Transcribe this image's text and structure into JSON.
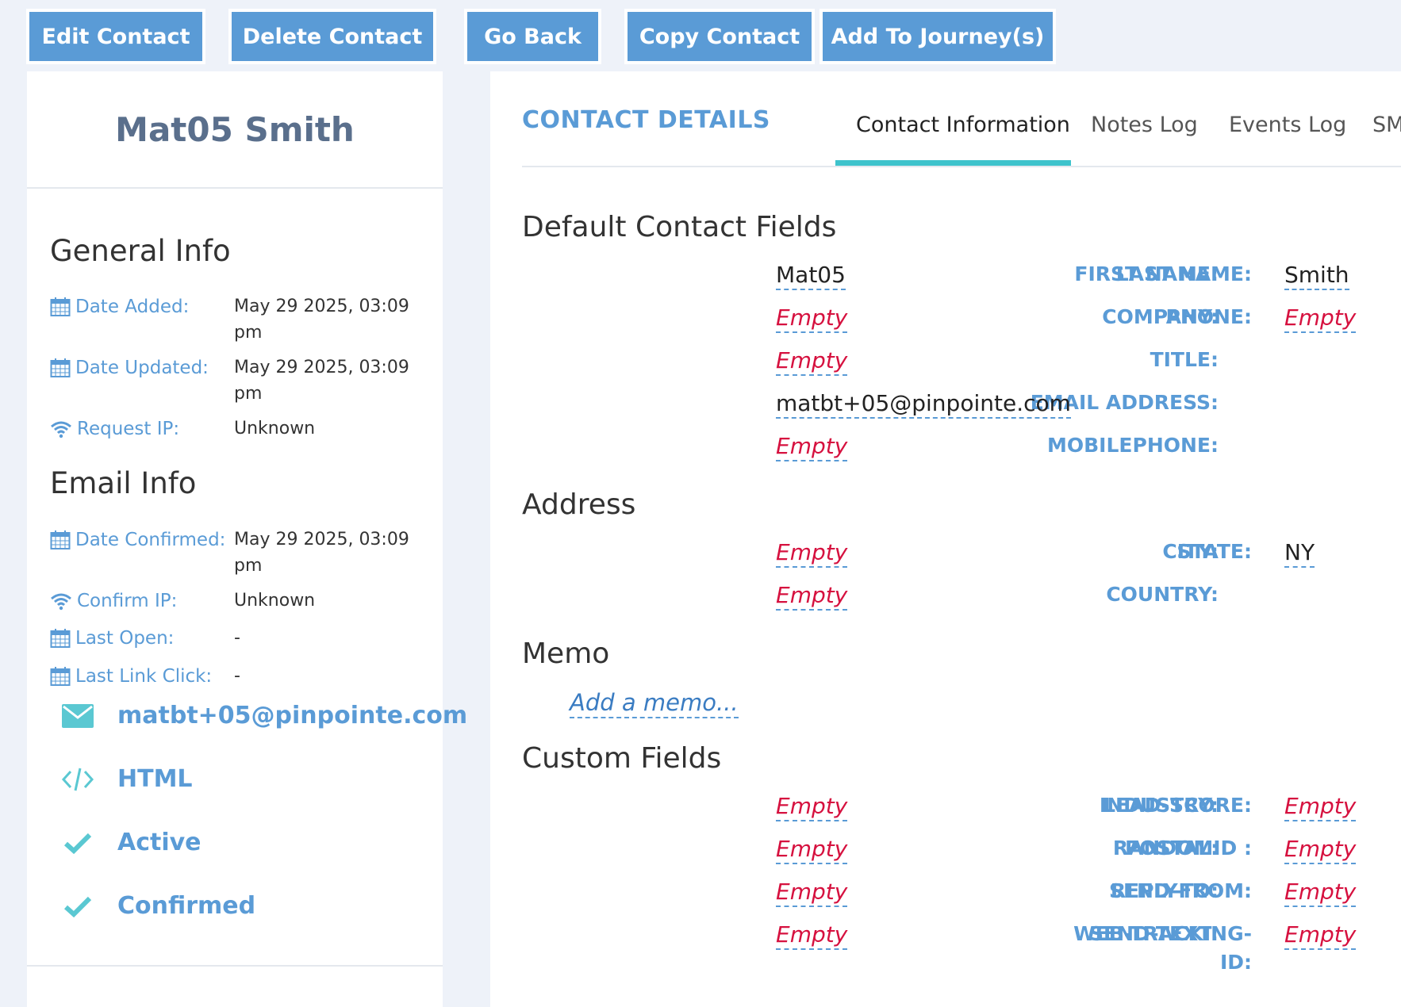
{
  "toolbar": {
    "edit": "Edit Contact",
    "delete": "Delete Contact",
    "back": "Go Back",
    "copy": "Copy Contact",
    "journey": "Add To Journey(s)"
  },
  "contact": {
    "name": "Mat05 Smith"
  },
  "general_info": {
    "title": "General Info",
    "date_added_label": "Date Added:",
    "date_added_value": "May 29 2025, 03:09 pm",
    "date_updated_label": "Date Updated:",
    "date_updated_value": "May 29 2025, 03:09 pm",
    "request_ip_label": "Request IP:",
    "request_ip_value": "Unknown"
  },
  "email_info": {
    "title": "Email Info",
    "date_confirmed_label": "Date Confirmed:",
    "date_confirmed_value": "May 29 2025, 03:09 pm",
    "confirm_ip_label": "Confirm IP:",
    "confirm_ip_value": "Unknown",
    "last_open_label": "Last Open:",
    "last_open_value": "-",
    "last_link_click_label": "Last Link Click:",
    "last_link_click_value": "-",
    "email": "matbt+05@pinpointe.com",
    "format": "HTML",
    "status": "Active",
    "confirmation": "Confirmed"
  },
  "details": {
    "title": "CONTACT DETAILS",
    "tabs": [
      "Contact Information",
      "Notes Log",
      "Events Log",
      "SM"
    ]
  },
  "default_fields": {
    "title": "Default Contact Fields",
    "first_name_label": "FIRST NAME:",
    "first_name_value": "Mat05",
    "last_name_label": "LAST NAME:",
    "last_name_value": "Smith",
    "company_label": "COMPANY:",
    "company_value": "Empty",
    "phone_label": "PHONE:",
    "phone_value": "Empty",
    "title_label": "TITLE:",
    "title_value": "Empty",
    "email_label": "EMAIL ADDRESS:",
    "email_value": "matbt+05@pinpointe.com",
    "mobile_label": "MOBILEPHONE:",
    "mobile_value": "Empty"
  },
  "address": {
    "title": "Address",
    "city_label": "CITY:",
    "city_value": "Empty",
    "state_label": "STATE:",
    "state_value": "NY",
    "country_label": "COUNTRY:",
    "country_value": "Empty"
  },
  "memo": {
    "title": "Memo",
    "link": "Add a memo..."
  },
  "custom_fields": {
    "title": "Custom Fields",
    "industry_label": "INDUSTRY:",
    "industry_value": "Empty",
    "lead_score_label": "LEAD-SCORE:",
    "lead_score_value": "Empty",
    "postal_label": "POSTAL:",
    "postal_value": "Empty",
    "randomid_label": "RANDOMID :",
    "randomid_value": "Empty",
    "reply_to_label": "REPLY-TO:",
    "reply_to_value": "Empty",
    "send_from_label": "SEND-FROM:",
    "send_from_value": "Empty",
    "send_text_label": "SEND-TEXT:",
    "send_text_value": "Empty",
    "web_tracking_label": "WEB-TRACKING-ID:",
    "web_tracking_value": "Empty"
  },
  "colors": {
    "accent": "#5a9bd6",
    "tab_underline": "#3ec3cc",
    "empty_value": "#d6113f",
    "name_text": "#5a6f8c"
  },
  "icons": [
    "calendar-icon",
    "wifi-icon",
    "envelope-icon",
    "code-icon",
    "check-icon"
  ]
}
